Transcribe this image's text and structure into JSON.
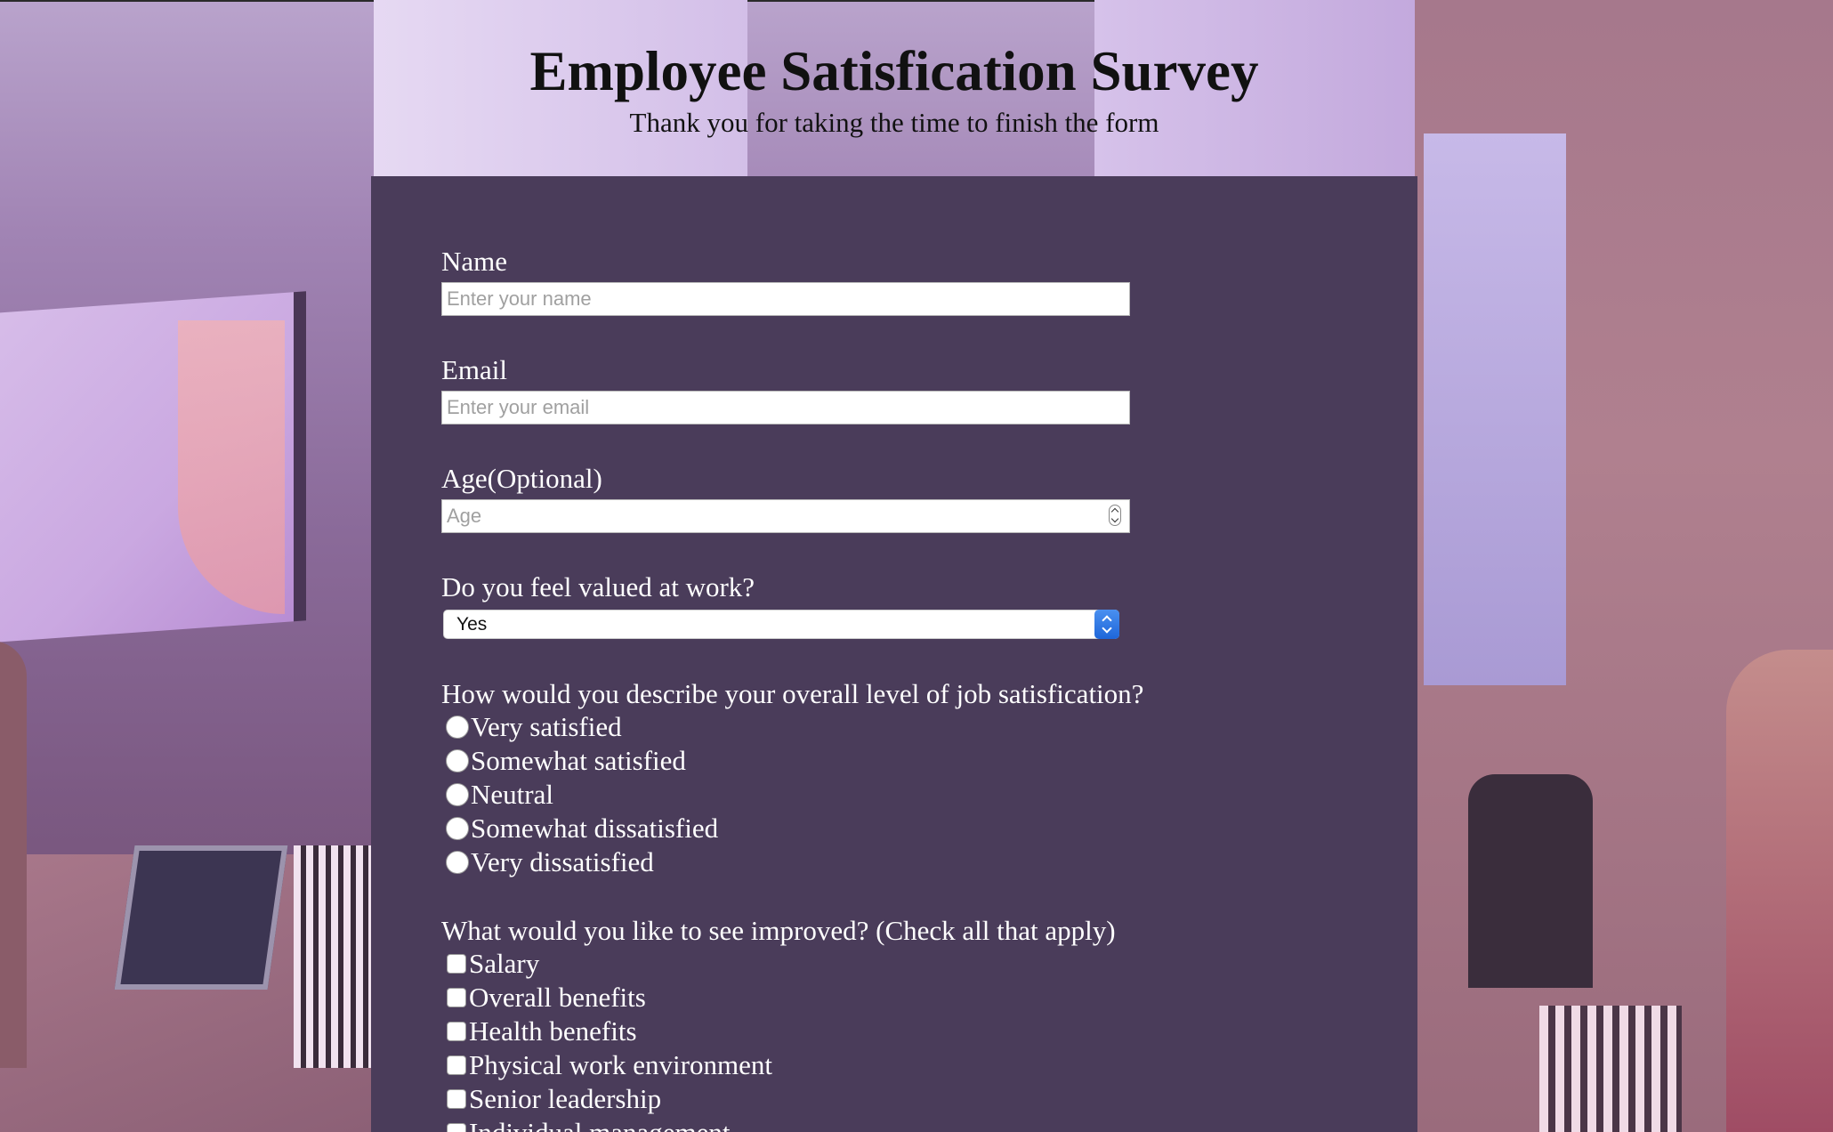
{
  "header": {
    "title": "Employee Satisfication Survey",
    "subtitle": "Thank you for taking the time to finish the form"
  },
  "form": {
    "name": {
      "label": "Name",
      "placeholder": "Enter your name",
      "value": ""
    },
    "email": {
      "label": "Email",
      "placeholder": "Enter your email",
      "value": ""
    },
    "age": {
      "label": "Age(Optional)",
      "placeholder": "Age",
      "value": ""
    },
    "valued": {
      "label": "Do you feel valued at work?",
      "selected": "Yes"
    },
    "satisfaction": {
      "label": "How would you describe your overall level of job satisfication?",
      "options": [
        "Very satisfied",
        "Somewhat satisfied",
        "Neutral",
        "Somewhat dissatisfied",
        "Very dissatisfied"
      ]
    },
    "improvements": {
      "label": "What would you like to see improved? (Check all that apply)",
      "options": [
        "Salary",
        "Overall benefits",
        "Health benefits",
        "Physical work environment",
        "Senior leadership",
        "Individual management"
      ]
    }
  },
  "colors": {
    "panel_background": "#4a3c5a",
    "select_accent": "#1e66d9"
  }
}
